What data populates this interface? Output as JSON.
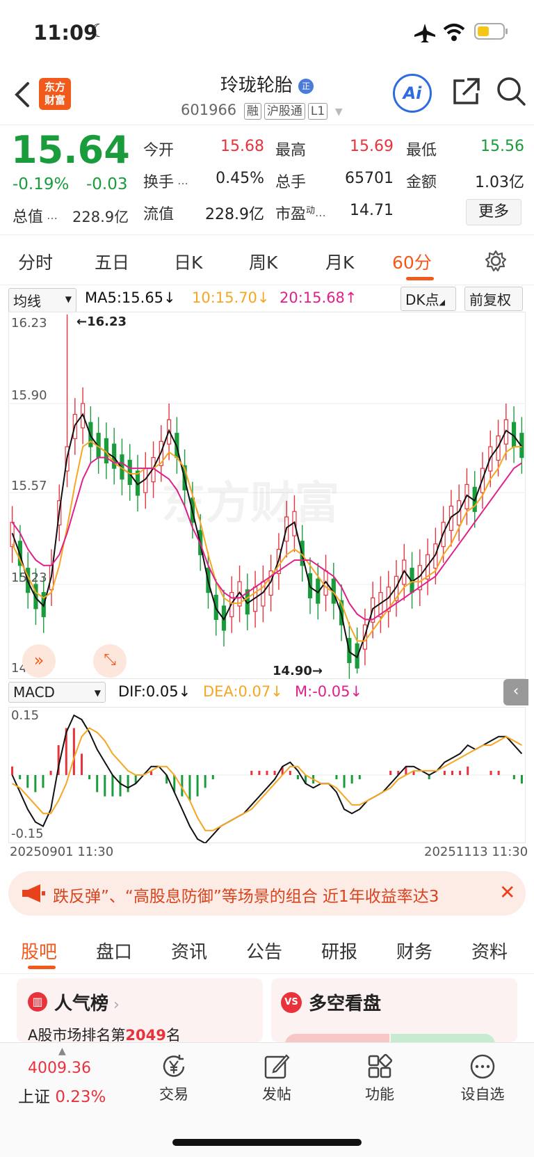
{
  "status": {
    "time": "11:09"
  },
  "header": {
    "logo_line1": "东方",
    "logo_line2": "财富",
    "stock_name": "玲珑轮胎",
    "stock_code": "601966",
    "tags": [
      "融",
      "沪股通",
      "L1"
    ],
    "ai_label": "Ai"
  },
  "quote": {
    "price": "15.64",
    "change_pct": "-0.19%",
    "change": "-0.03",
    "open_label": "今开",
    "open": "15.68",
    "high_label": "最高",
    "high": "15.69",
    "low_label": "最低",
    "low": "15.56",
    "turnover_label": "换手",
    "turnover": "0.45%",
    "volume_label": "总手",
    "volume": "65701",
    "amount_label": "金额",
    "amount": "1.03亿",
    "mcap_label": "总值",
    "mcap": "228.9亿",
    "float_label": "流值",
    "float": "228.9亿",
    "pe_label": "市盈",
    "pe_sup": "动",
    "pe": "14.71",
    "more_label": "更多"
  },
  "periods": [
    "分时",
    "五日",
    "日K",
    "周K",
    "月K",
    "60分"
  ],
  "active_period": "60分",
  "ma": {
    "selector": "均线",
    "ma5": "MA5:15.65↓",
    "ma10": "10:15.70↓",
    "ma20": "20:15.68↑",
    "dk": "DK点",
    "adjust": "前复权"
  },
  "macd": {
    "selector": "MACD",
    "dif": "DIF:0.05↓",
    "dea": "DEA:0.07↓",
    "m": "M:-0.05↓"
  },
  "colors": {
    "up": "#e8323c",
    "down": "#1a9c3c",
    "ma5": "#111111",
    "ma10": "#f5a623",
    "ma20": "#e0208a",
    "accent": "#f25a1c"
  },
  "chart_data": [
    {
      "type": "candlestick",
      "y_ticks": [
        "16.23",
        "15.90",
        "15.57",
        "15.23",
        "14.90"
      ],
      "ylim": [
        14.9,
        16.23
      ],
      "max_label": "←16.23",
      "min_label": "14.90→",
      "watermark": "东方财富",
      "x_start": "20250901 11:30",
      "x_end": "20251113 11:30",
      "series": [
        {
          "name": "MA5",
          "values": [
            15.42,
            15.34,
            15.24,
            15.18,
            15.15,
            15.26,
            15.5,
            15.7,
            15.82,
            15.86,
            15.78,
            15.74,
            15.72,
            15.7,
            15.66,
            15.64,
            15.6,
            15.62,
            15.66,
            15.72,
            15.8,
            15.74,
            15.62,
            15.5,
            15.38,
            15.24,
            15.14,
            15.1,
            15.16,
            15.2,
            15.16,
            15.18,
            15.2,
            15.24,
            15.32,
            15.44,
            15.46,
            15.34,
            15.22,
            15.2,
            15.24,
            15.2,
            15.12,
            14.98,
            14.96,
            15.04,
            15.14,
            15.16,
            15.18,
            15.22,
            15.28,
            15.24,
            15.26,
            15.3,
            15.34,
            15.42,
            15.48,
            15.5,
            15.56,
            15.54,
            15.62,
            15.7,
            15.74,
            15.8,
            15.78,
            15.74
          ]
        },
        {
          "name": "MA10",
          "values": [
            15.38,
            15.32,
            15.26,
            15.2,
            15.18,
            15.2,
            15.3,
            15.44,
            15.6,
            15.74,
            15.76,
            15.74,
            15.72,
            15.68,
            15.66,
            15.64,
            15.64,
            15.66,
            15.66,
            15.68,
            15.72,
            15.7,
            15.66,
            15.56,
            15.46,
            15.34,
            15.24,
            15.18,
            15.16,
            15.16,
            15.18,
            15.2,
            15.22,
            15.26,
            15.3,
            15.34,
            15.36,
            15.34,
            15.3,
            15.26,
            15.22,
            15.2,
            15.16,
            15.08,
            15.02,
            15.02,
            15.06,
            15.1,
            15.14,
            15.18,
            15.22,
            15.24,
            15.24,
            15.26,
            15.28,
            15.34,
            15.38,
            15.44,
            15.5,
            15.52,
            15.56,
            15.62,
            15.66,
            15.72,
            15.74,
            15.74
          ]
        },
        {
          "name": "MA20",
          "values": [
            15.46,
            15.42,
            15.36,
            15.32,
            15.3,
            15.3,
            15.34,
            15.42,
            15.52,
            15.62,
            15.68,
            15.7,
            15.7,
            15.68,
            15.68,
            15.66,
            15.66,
            15.66,
            15.66,
            15.64,
            15.62,
            15.58,
            15.52,
            15.44,
            15.38,
            15.3,
            15.24,
            15.2,
            15.18,
            15.18,
            15.2,
            15.22,
            15.24,
            15.26,
            15.28,
            15.3,
            15.32,
            15.32,
            15.32,
            15.3,
            15.28,
            15.26,
            15.22,
            15.16,
            15.12,
            15.1,
            15.1,
            15.12,
            15.14,
            15.16,
            15.18,
            15.2,
            15.22,
            15.24,
            15.26,
            15.3,
            15.34,
            15.38,
            15.42,
            15.46,
            15.5,
            15.54,
            15.58,
            15.62,
            15.66,
            15.68
          ]
        }
      ]
    },
    {
      "type": "macd",
      "y_ticks": [
        "0.15",
        "-0.15"
      ],
      "ylim": [
        -0.15,
        0.15
      ],
      "series": [
        {
          "name": "DIF",
          "values": [
            0.0,
            -0.04,
            -0.08,
            -0.11,
            -0.12,
            -0.08,
            0.02,
            0.1,
            0.14,
            0.13,
            0.1,
            0.06,
            0.03,
            0.0,
            -0.02,
            -0.03,
            -0.02,
            0.0,
            0.02,
            0.02,
            0.0,
            -0.04,
            -0.08,
            -0.12,
            -0.15,
            -0.16,
            -0.14,
            -0.12,
            -0.11,
            -0.1,
            -0.09,
            -0.07,
            -0.05,
            -0.03,
            -0.01,
            0.02,
            0.03,
            0.01,
            -0.02,
            -0.03,
            -0.02,
            -0.02,
            -0.04,
            -0.08,
            -0.09,
            -0.08,
            -0.06,
            -0.05,
            -0.04,
            -0.02,
            0.0,
            0.02,
            0.02,
            0.01,
            0.0,
            0.01,
            0.03,
            0.04,
            0.05,
            0.07,
            0.06,
            0.07,
            0.08,
            0.09,
            0.09,
            0.07,
            0.05
          ]
        },
        {
          "name": "DEA",
          "values": [
            -0.02,
            -0.03,
            -0.05,
            -0.07,
            -0.09,
            -0.09,
            -0.06,
            -0.02,
            0.04,
            0.09,
            0.11,
            0.1,
            0.08,
            0.05,
            0.03,
            0.01,
            0.0,
            0.0,
            0.01,
            0.02,
            0.02,
            0.0,
            -0.03,
            -0.06,
            -0.1,
            -0.13,
            -0.13,
            -0.12,
            -0.11,
            -0.1,
            -0.09,
            -0.08,
            -0.06,
            -0.04,
            -0.02,
            0.0,
            0.02,
            0.02,
            0.0,
            -0.01,
            -0.02,
            -0.02,
            -0.03,
            -0.05,
            -0.07,
            -0.07,
            -0.06,
            -0.05,
            -0.04,
            -0.03,
            -0.01,
            0.0,
            0.01,
            0.01,
            0.01,
            0.01,
            0.02,
            0.03,
            0.04,
            0.05,
            0.06,
            0.07,
            0.07,
            0.08,
            0.09,
            0.08,
            0.07
          ]
        },
        {
          "name": "M",
          "values": [
            0.04,
            -0.02,
            -0.06,
            -0.08,
            -0.06,
            0.02,
            0.14,
            0.22,
            0.22,
            0.1,
            -0.02,
            -0.08,
            -0.1,
            -0.1,
            -0.1,
            -0.08,
            -0.04,
            0.0,
            0.02,
            0.0,
            -0.04,
            -0.08,
            -0.1,
            -0.12,
            -0.1,
            -0.06,
            -0.02,
            0.0,
            0.0,
            0.0,
            0.0,
            0.02,
            0.02,
            0.02,
            0.02,
            0.04,
            0.02,
            -0.02,
            -0.04,
            -0.04,
            0.0,
            0.0,
            -0.02,
            -0.06,
            -0.04,
            -0.02,
            0.0,
            0.0,
            0.0,
            0.02,
            0.02,
            0.04,
            0.02,
            0.0,
            -0.02,
            0.0,
            0.02,
            0.02,
            0.02,
            0.04,
            0.0,
            0.0,
            0.02,
            0.02,
            0.0,
            -0.02,
            -0.04
          ]
        }
      ]
    }
  ],
  "notice": {
    "text": "跌反弹”、“高股息防御”等场景的组合 近1年收益率达3"
  },
  "bottom_tabs": [
    "股吧",
    "盘口",
    "资讯",
    "公告",
    "研报",
    "财务",
    "资料"
  ],
  "active_bottom_tab": "股吧",
  "cards": {
    "popularity_title": "人气榜",
    "popularity_prefix": "A股市场排名第",
    "popularity_rank": "2049",
    "popularity_suffix": "名",
    "vs_title": "多空看盘"
  },
  "nav": {
    "index_value": "4009.36",
    "index_name": "上证",
    "index_change": "0.23%",
    "items": [
      "交易",
      "发帖",
      "功能",
      "设自选"
    ]
  }
}
